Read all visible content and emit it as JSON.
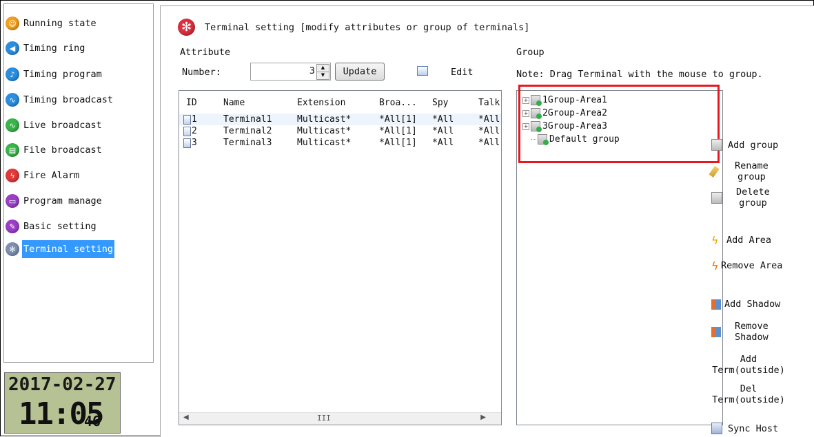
{
  "sidebar": {
    "items": [
      {
        "label": "Running state",
        "color": "#f0a020",
        "glyph": "☺"
      },
      {
        "label": "Timing ring",
        "color": "#2a8fe0",
        "glyph": "◀"
      },
      {
        "label": "Timing program",
        "color": "#2a8fe0",
        "glyph": "♪"
      },
      {
        "label": "Timing broadcast",
        "color": "#2a8fe0",
        "glyph": "∿"
      },
      {
        "label": "Live broadcast",
        "color": "#39b54a",
        "glyph": "∿"
      },
      {
        "label": "File broadcast",
        "color": "#39b54a",
        "glyph": "▤"
      },
      {
        "label": "Fire Alarm",
        "color": "#e03a3a",
        "glyph": "ϟ"
      },
      {
        "label": "Program manage",
        "color": "#9b3fc6",
        "glyph": "▭"
      },
      {
        "label": "Basic setting",
        "color": "#9b3fc6",
        "glyph": "✎"
      },
      {
        "label": "Terminal setting",
        "color": "#7e8fb0",
        "glyph": "✻"
      }
    ],
    "active_index": 9
  },
  "clock": {
    "date": "2017-02-27",
    "time": "11:05",
    "seconds": "46"
  },
  "header": {
    "title": "Terminal setting [modify attributes or group of terminals]"
  },
  "attribute": {
    "legend": "Attribute",
    "number_label": "Number:",
    "number_value": "3",
    "update_label": "Update",
    "edit_label": "Edit"
  },
  "table": {
    "columns": [
      "ID",
      "Name",
      "Extension",
      "Broa...",
      "Spy",
      "Talk"
    ],
    "rows": [
      {
        "id": "1",
        "name": "Terminal1",
        "extension": "Multicast*",
        "broadcast": "*All[1]",
        "spy": "*All",
        "talk": "*All"
      },
      {
        "id": "2",
        "name": "Terminal2",
        "extension": "Multicast*",
        "broadcast": "*All[1]",
        "spy": "*All",
        "talk": "*All"
      },
      {
        "id": "3",
        "name": "Terminal3",
        "extension": "Multicast*",
        "broadcast": "*All[1]",
        "spy": "*All",
        "talk": "*All"
      }
    ],
    "scroll_grip": "III"
  },
  "group": {
    "legend": "Group",
    "note": "Note: Drag Terminal with the mouse to group.",
    "tree": [
      {
        "label": "1Group-Area1",
        "expandable": true
      },
      {
        "label": "2Group-Area2",
        "expandable": true
      },
      {
        "label": "3Group-Area3",
        "expandable": true
      },
      {
        "label": "Default group",
        "expandable": false
      }
    ]
  },
  "actions": {
    "add_group": "Add group",
    "rename_group": [
      "Rename",
      "group"
    ],
    "delete_group": [
      "Delete",
      "group"
    ],
    "add_area": "Add Area",
    "remove_area": "Remove Area",
    "add_shadow": "Add Shadow",
    "remove_shadow": [
      "Remove",
      "Shadow"
    ],
    "add_term": [
      "Add",
      "Term(outside)"
    ],
    "del_term": [
      "Del",
      "Term(outside)"
    ],
    "sync_host": "Sync Host"
  }
}
